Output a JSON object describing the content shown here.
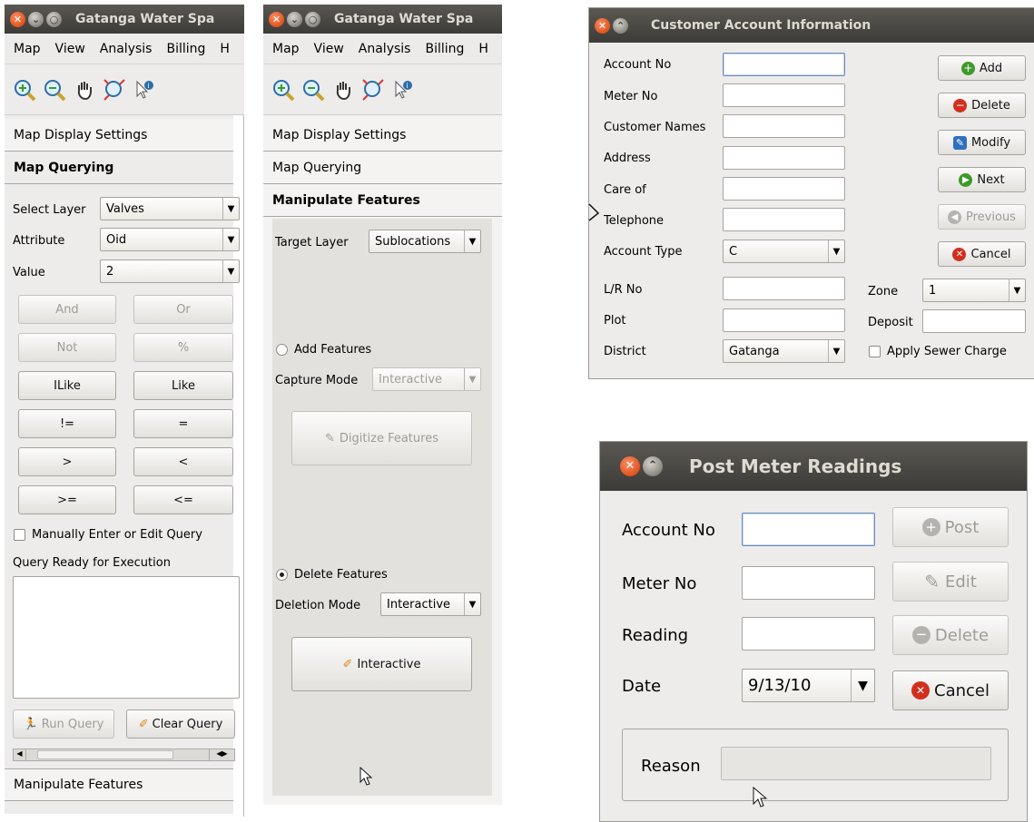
{
  "panel1": {
    "title": "Gatanga Water Spa",
    "menu": [
      "Map",
      "View",
      "Analysis",
      "Billing",
      "H"
    ],
    "tabs": {
      "display": "Map Display Settings",
      "querying": "Map Querying",
      "manipulate": "Manipulate Features"
    },
    "select_layer_label": "Select Layer",
    "select_layer_value": "Valves",
    "attribute_label": "Attribute",
    "attribute_value": "Oid",
    "value_label": "Value",
    "value_value": "2",
    "ops": [
      "And",
      "Or",
      "Not",
      "%",
      "ILike",
      "Like",
      "!=",
      "=",
      ">",
      "<",
      ">=",
      "<="
    ],
    "manual_edit_label": "Manually Enter or Edit Query",
    "query_ready_label": "Query Ready for Execution",
    "run_query": "Run Query",
    "clear_query": "Clear Query"
  },
  "panel2": {
    "title": "Gatanga Water Spa",
    "menu": [
      "Map",
      "View",
      "Analysis",
      "Billing",
      "H"
    ],
    "tabs": {
      "display": "Map Display Settings",
      "querying": "Map Querying",
      "manipulate": "Manipulate Features"
    },
    "target_layer_label": "Target Layer",
    "target_layer_value": "Sublocations",
    "add_features": "Add Features",
    "capture_mode_label": "Capture Mode",
    "capture_mode_value": "Interactive",
    "digitize": "Digitize Features",
    "delete_features": "Delete Features",
    "deletion_mode_label": "Deletion Mode",
    "deletion_mode_value": "Interactive",
    "interactive_button": "Interactive"
  },
  "customer": {
    "title": "Customer Account Information",
    "labels": {
      "account_no": "Account No",
      "meter_no": "Meter No",
      "customer_names": "Customer Names",
      "address": "Address",
      "care_of": "Care of",
      "telephone": "Telephone",
      "account_type": "Account Type",
      "lr_no": "L/R No",
      "plot": "Plot",
      "district": "District",
      "zone": "Zone",
      "deposit": "Deposit",
      "apply_sewer": "Apply Sewer Charge"
    },
    "account_type_value": "C",
    "district_value": "Gatanga",
    "zone_value": "1",
    "buttons": {
      "add": "Add",
      "delete": "Delete",
      "modify": "Modify",
      "next": "Next",
      "previous": "Previous",
      "cancel": "Cancel"
    }
  },
  "meter": {
    "title": "Post Meter Readings",
    "labels": {
      "account_no": "Account No",
      "meter_no": "Meter No",
      "reading": "Reading",
      "date": "Date",
      "reason": "Reason"
    },
    "date_value": "9/13/10",
    "buttons": {
      "post": "Post",
      "edit": "Edit",
      "delete": "Delete",
      "cancel": "Cancel"
    }
  },
  "colors": {
    "title_bg": "#3c3b37",
    "close": "#e2531c",
    "focus_border": "#6a8cbc",
    "add_green": "#3e9a2b",
    "delete_red": "#d22e1e"
  }
}
